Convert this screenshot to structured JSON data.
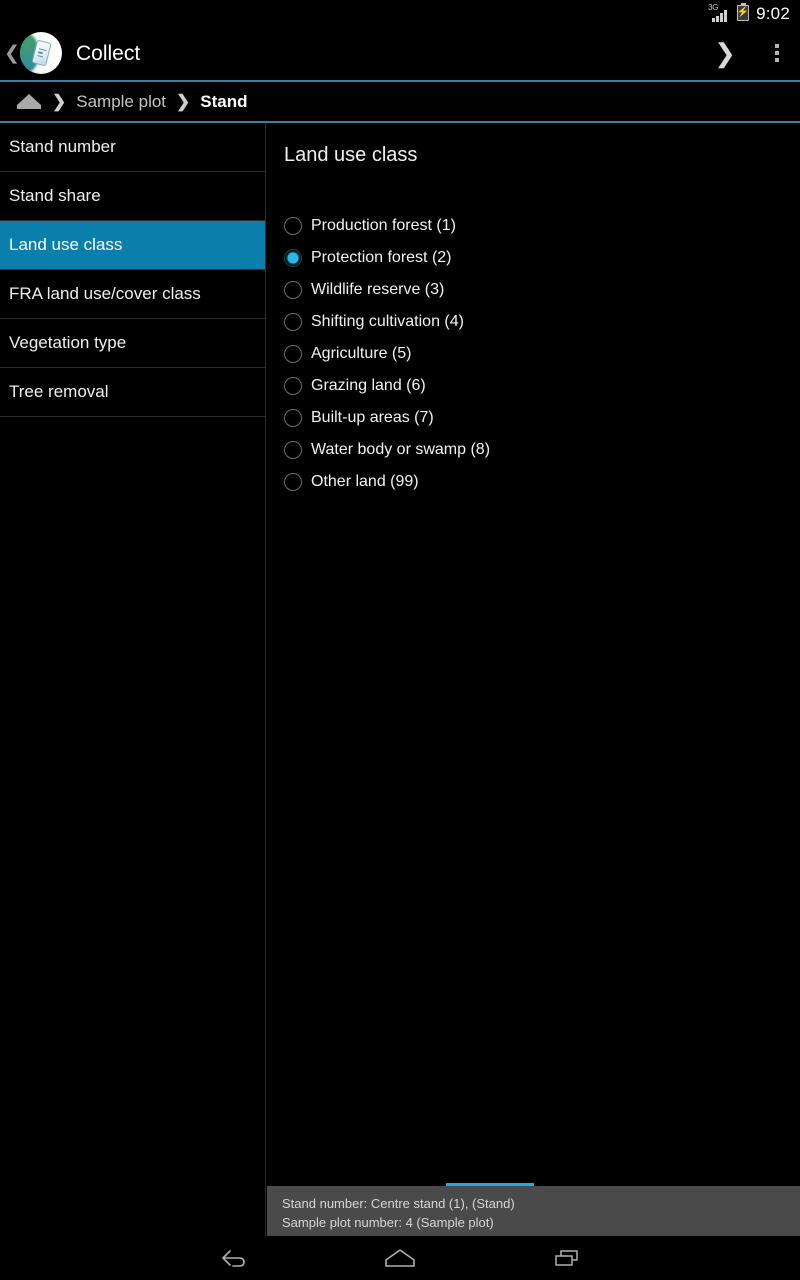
{
  "status_bar": {
    "network_label": "3G",
    "battery_icon": "battery-charging-icon",
    "signal_icon": "signal-bars-icon",
    "time": "9:02"
  },
  "app_bar": {
    "up_icon": "back-chevron-icon",
    "logo_icon": "collect-app-logo-icon",
    "title": "Collect",
    "forward_icon": "forward-chevron-icon",
    "overflow_icon": "overflow-menu-icon"
  },
  "breadcrumb": {
    "home_icon": "home-icon",
    "separator": "❯",
    "items": [
      {
        "label": "Sample plot",
        "current": false
      },
      {
        "label": "Stand",
        "current": true
      }
    ]
  },
  "sidebar": {
    "items": [
      {
        "label": "Stand number",
        "selected": false
      },
      {
        "label": "Stand share",
        "selected": false
      },
      {
        "label": "Land use class",
        "selected": true
      },
      {
        "label": "FRA land use/cover class",
        "selected": false
      },
      {
        "label": "Vegetation type",
        "selected": false
      },
      {
        "label": "Tree removal",
        "selected": false
      }
    ]
  },
  "content": {
    "title": "Land use class",
    "options": [
      {
        "label": "Production forest (1)",
        "checked": false
      },
      {
        "label": "Protection forest (2)",
        "checked": true
      },
      {
        "label": "Wildlife reserve (3)",
        "checked": false
      },
      {
        "label": "Shifting cultivation (4)",
        "checked": false
      },
      {
        "label": "Agriculture (5)",
        "checked": false
      },
      {
        "label": "Grazing land (6)",
        "checked": false
      },
      {
        "label": "Built-up areas (7)",
        "checked": false
      },
      {
        "label": "Water body or swamp (8)",
        "checked": false
      },
      {
        "label": "Other land (99)",
        "checked": false
      }
    ]
  },
  "toast": {
    "line1": "Stand number: Centre stand (1),  (Stand)",
    "line2": "Sample plot number: 4 (Sample plot)"
  },
  "nav_bar": {
    "back_icon": "nav-back-icon",
    "home_icon": "nav-home-icon",
    "recents_icon": "nav-recents-icon"
  },
  "colors": {
    "accent_teal": "#0b7fab",
    "accent_cyan": "#29b6e8",
    "divider_blue": "#3e7fa0",
    "toast_bg": "#4a4a4a"
  }
}
